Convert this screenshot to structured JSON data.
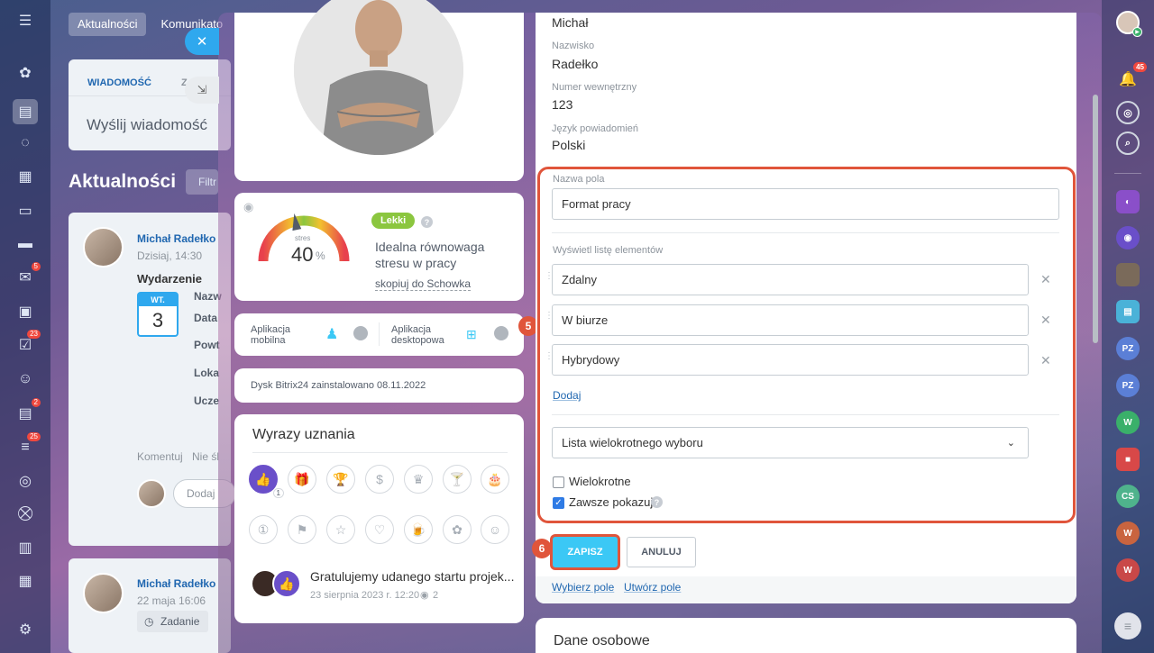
{
  "background": {
    "tabs": [
      "Aktualności",
      "Komunikato"
    ],
    "composer_tab": "WIADOMOŚĆ",
    "composer_tab2": "Z",
    "composer_placeholder": "Wyślij wiadomość",
    "feed_title": "Aktualności",
    "filter_stub": "Filtr",
    "post1": {
      "author": "Michał Radełko",
      "time": "Dzisiaj, 14:30",
      "type": "Wydarzenie",
      "cal_day": "WT.",
      "cal_num": "3",
      "fields": [
        "Nazw",
        "Data",
        "Powt",
        "Loka",
        "Ucze"
      ],
      "comment": "Komentuj",
      "unfollow": "Nie śl",
      "reply_placeholder": "Dodaj"
    },
    "post2": {
      "author": "Michał Radełko",
      "time": "22 maja 16:06",
      "tag": "Zadanie"
    }
  },
  "left_rail_badges": {
    "mail": "5",
    "tasks": "23",
    "chat": "2",
    "feed": "25"
  },
  "stress": {
    "level_label": "Lekki",
    "caption": "stres",
    "value": "40",
    "unit": "%",
    "gauge_fraction": 0.4,
    "description_line1": "Idealna równowaga",
    "description_line2": "stresu w pracy",
    "copy_link": "skopiuj do Schowka"
  },
  "apps": {
    "mobile_line1": "Aplikacja",
    "mobile_line2": "mobilna",
    "desktop_line1": "Aplikacja",
    "desktop_line2": "desktopowa",
    "step": "5"
  },
  "disk_text": "Dysk Bitrix24 zainstalowano 08.11.2022",
  "kudos": {
    "title": "Wyrazy uznania",
    "count": "1",
    "post_text": "Gratulujemy udanego startu projek...",
    "post_date": "23 sierpnia 2023 r. 12:20",
    "views": "2"
  },
  "profile": {
    "first_name": "Michał",
    "last_name_label": "Nazwisko",
    "last_name": "Radełko",
    "ext_label": "Numer wewnętrzny",
    "ext": "123",
    "lang_label": "Język powiadomień",
    "lang": "Polski"
  },
  "field_editor": {
    "name_label": "Nazwa pola",
    "name_value": "Format pracy",
    "list_label": "Wyświetl listę elementów",
    "items": [
      "Zdalny",
      "W biurze",
      "Hybrydowy"
    ],
    "add_link": "Dodaj",
    "type_select": "Lista wielokrotnego wyboru",
    "multiple_label": "Wielokrotne",
    "multiple_checked": false,
    "always_label": "Zawsze pokazuj",
    "always_checked": true
  },
  "actions": {
    "save": "ZAPISZ",
    "cancel": "ANULUJ",
    "step": "6",
    "pick_field": "Wybierz pole",
    "create_field": "Utwórz pole"
  },
  "personal_title": "Dane osobowe",
  "right_rail": {
    "notifications": "45",
    "avatars": [
      "PZ",
      "PZ",
      "W",
      "CS",
      "W",
      "W"
    ],
    "colors": {
      "pz": "#5b7fd6",
      "w": "#3ab06a",
      "cs": "#4fb38c",
      "w2": "#c9643f",
      "w3": "#c94848"
    }
  },
  "colors": {
    "accent": "#3bc8f5",
    "highlight": "#e0553b",
    "link": "#2067b0"
  }
}
